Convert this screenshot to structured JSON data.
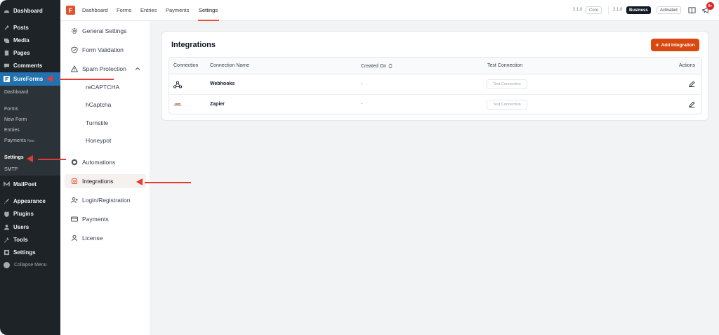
{
  "wp_sidebar": {
    "items": [
      {
        "label": "Dashboard",
        "icon": "dashboard-icon"
      },
      {
        "label": "Posts",
        "icon": "pin-icon"
      },
      {
        "label": "Media",
        "icon": "media-icon"
      },
      {
        "label": "Pages",
        "icon": "pages-icon"
      },
      {
        "label": "Comments",
        "icon": "comment-icon"
      },
      {
        "label": "SureForms",
        "icon": "sureforms-icon"
      },
      {
        "label": "MailPoet",
        "icon": "mailpoet-icon"
      },
      {
        "label": "Appearance",
        "icon": "brush-icon"
      },
      {
        "label": "Plugins",
        "icon": "plugin-icon"
      },
      {
        "label": "Users",
        "icon": "users-icon"
      },
      {
        "label": "Tools",
        "icon": "wrench-icon"
      },
      {
        "label": "Settings",
        "icon": "settings-icon"
      }
    ],
    "sub": {
      "dashboard": "Dashboard",
      "forms": "Forms",
      "new_form": "New Form",
      "entries": "Entries",
      "payments": "Payments",
      "payments_badge": "New",
      "settings": "Settings",
      "smtp": "SMTP"
    },
    "collapse": "Collapse Menu"
  },
  "topbar": {
    "logo": "F",
    "nav": [
      "Dashboard",
      "Forms",
      "Entries",
      "Payments",
      "Settings"
    ],
    "version_core": "2.1.0",
    "core_label": "Core",
    "version_business": "2.1.0",
    "business_label": "Business",
    "activated_label": "Activated",
    "notification_count": "9+"
  },
  "settings_nav": {
    "items": [
      {
        "label": "General Settings",
        "icon": "gear-icon"
      },
      {
        "label": "Form Validation",
        "icon": "shield-icon"
      },
      {
        "label": "Spam Protection",
        "icon": "warning-icon"
      },
      {
        "label": "Automations",
        "icon": "automation-icon"
      },
      {
        "label": "Integrations",
        "icon": "integration-icon"
      },
      {
        "label": "Login/Registration",
        "icon": "user-plus-icon"
      },
      {
        "label": "Payments",
        "icon": "card-icon"
      },
      {
        "label": "License",
        "icon": "user-icon"
      }
    ],
    "spam_children": [
      "reCAPTCHA",
      "hCaptcha",
      "Turnstile",
      "Honeypot"
    ]
  },
  "main": {
    "title": "Integrations",
    "add_button": "Add Integration",
    "columns": [
      "Connection",
      "Connection Name",
      "Created On",
      "Test Connection",
      "Actions"
    ],
    "rows": [
      {
        "icon": "webhook-icon",
        "name": "Webhooks",
        "created": "-",
        "test": "Test Connection"
      },
      {
        "icon": "zapier-icon",
        "name": "Zapier",
        "created": "-",
        "test": "Test Connection"
      }
    ]
  },
  "colors": {
    "accent": "#d9480f",
    "wp_dark": "#1d2327",
    "wp_active": "#2271b1",
    "arrow": "#e53935"
  }
}
